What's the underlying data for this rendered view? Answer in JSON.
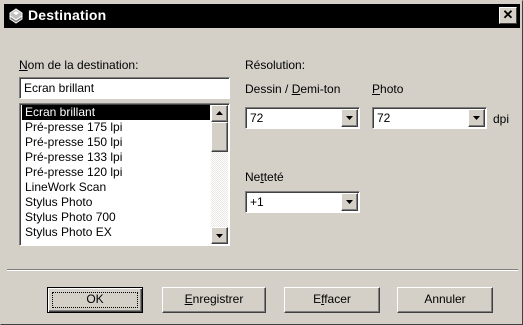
{
  "window": {
    "title": "Destination",
    "close_glyph": "✕",
    "icon": "printer-destination-icon"
  },
  "destination": {
    "label_underline": "N",
    "label_rest": "om de la destination:",
    "name_value": "Ecran brillant",
    "list": [
      "Ecran brillant",
      "Pré-presse 175 lpi",
      "Pré-presse 150 lpi",
      "Pré-presse 133 lpi",
      "Pré-presse 120 lpi",
      "LineWork Scan",
      "Stylus Photo",
      "Stylus Photo 700",
      "Stylus Photo EX"
    ],
    "selected_item": "Ecran brillant"
  },
  "resolution": {
    "label": "Résolution:",
    "dessin_label_pre": "Dessin / ",
    "dessin_label_ul": "D",
    "dessin_label_post": "emi-ton",
    "dessin_value": "72",
    "photo_label_ul": "P",
    "photo_label_rest": "hoto",
    "photo_value": "72",
    "unit": "dpi"
  },
  "sharpness": {
    "label_pre": "Ne",
    "label_ul": "t",
    "label_post": "teté",
    "value": "+1"
  },
  "buttons": {
    "ok": "OK",
    "save_ul": "E",
    "save_rest": "nregistrer",
    "delete_pre": "E",
    "delete_ul": "f",
    "delete_post": "facer",
    "cancel": "Annuler"
  }
}
